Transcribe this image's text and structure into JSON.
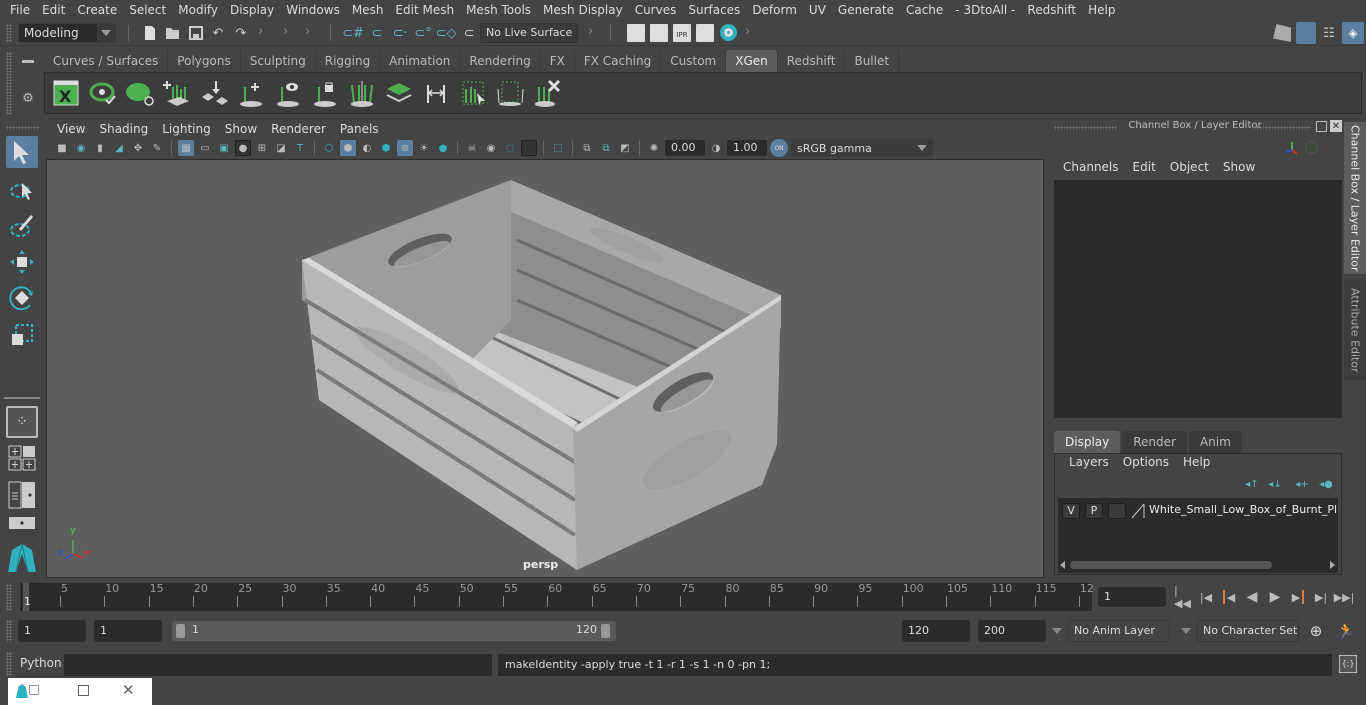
{
  "menubar": {
    "items": [
      "File",
      "Edit",
      "Create",
      "Select",
      "Modify",
      "Display",
      "Windows",
      "Mesh",
      "Edit Mesh",
      "Mesh Tools",
      "Mesh Display",
      "Curves",
      "Surfaces",
      "Deform",
      "UV",
      "Generate",
      "Cache",
      "- 3DtoAll -",
      "Redshift",
      "Help"
    ]
  },
  "statusline": {
    "menuset": "Modeling",
    "live_surface": "No Live Surface"
  },
  "shelf": {
    "tabs": [
      "Curves / Surfaces",
      "Polygons",
      "Sculpting",
      "Rigging",
      "Animation",
      "Rendering",
      "FX",
      "FX Caching",
      "Custom",
      "XGen",
      "Redshift",
      "Bullet"
    ],
    "active_tab": "XGen",
    "icons": [
      "xgen-description-editor-icon",
      "xgen-preview-icon",
      "xgen-clear-preview-icon",
      "xgen-add-guides-icon",
      "xgen-place-guides-icon",
      "xgen-add-guide-icon",
      "xgen-show-guides-icon",
      "xgen-lock-guides-icon",
      "xgen-split-guides-icon",
      "xgen-density-icon",
      "xgen-length-icon",
      "xgen-select-guides-icon",
      "xgen-bound-icon",
      "xgen-delete-guides-icon"
    ]
  },
  "viewport": {
    "menu": [
      "View",
      "Shading",
      "Lighting",
      "Show",
      "Renderer",
      "Panels"
    ],
    "exposure": "0.00",
    "gamma": "1.00",
    "color_management": "ON",
    "colorspace": "sRGB gamma",
    "camera_label": "persp",
    "axis": {
      "x": "x",
      "y": "y",
      "z": "z"
    }
  },
  "channelbox": {
    "title": "Channel Box / Layer Editor",
    "menu": [
      "Channels",
      "Edit",
      "Object",
      "Show"
    ]
  },
  "side_tabs": [
    "Channel Box / Layer Editor",
    "Attribute Editor"
  ],
  "layer_editor": {
    "tabs": [
      "Display",
      "Render",
      "Anim"
    ],
    "active_tab": "Display",
    "menu": [
      "Layers",
      "Options",
      "Help"
    ],
    "layers": [
      {
        "visible": "V",
        "playback": "P",
        "name": "White_Small_Low_Box_of_Burnt_Plan"
      }
    ]
  },
  "timeline": {
    "ticks": [
      "5",
      "10",
      "15",
      "20",
      "25",
      "30",
      "35",
      "40",
      "45",
      "50",
      "55",
      "60",
      "65",
      "70",
      "75",
      "80",
      "85",
      "90",
      "95",
      "100",
      "105",
      "110",
      "115",
      "12"
    ],
    "current_frame_marker": "1",
    "current_frame": "1"
  },
  "range": {
    "start_frame": "1",
    "playback_start": "1",
    "slider_min": "1",
    "slider_max": "120",
    "playback_end": "120",
    "end_frame": "200",
    "anim_layer": "No Anim Layer",
    "character_set": "No Character Set"
  },
  "cmdline": {
    "language": "Python",
    "input": "",
    "result": "makeIdentity -apply true -t 1 -r 1 -s 1 -n 0 -pn 1;"
  },
  "colors": {
    "accent_blue": "#5a7fa0",
    "xgen_green": "#4caf50",
    "teal": "#2fb1bf",
    "playhead_orange": "#e07b39"
  }
}
